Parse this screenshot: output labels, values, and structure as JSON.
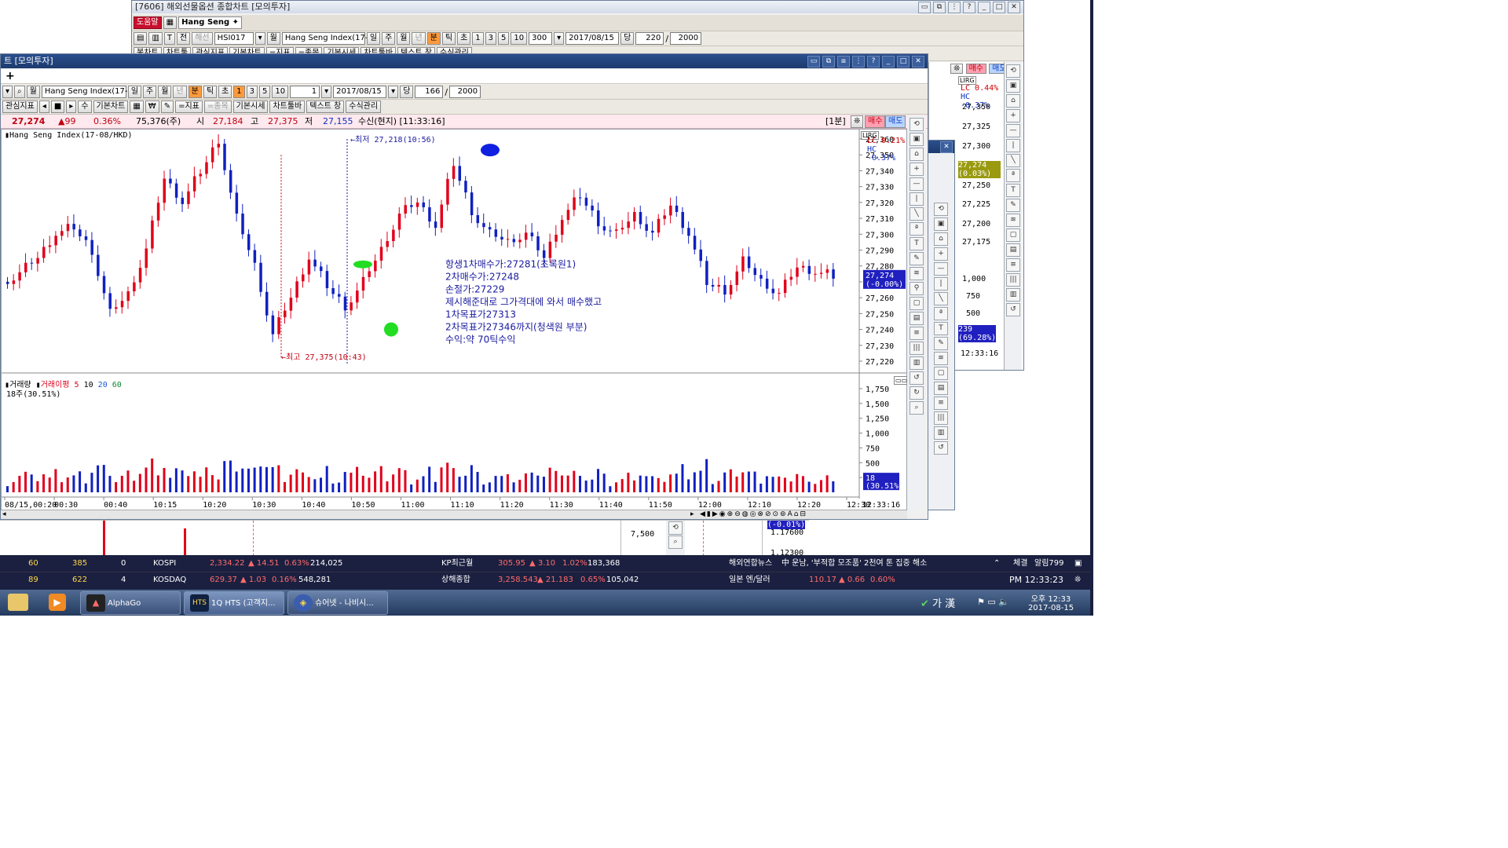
{
  "back_window": {
    "title": "[7606] 해외선물옵션 종합차트 [모의투자]",
    "help_btn": "도움말",
    "tab": "Hang Seng",
    "code": "HSI017",
    "period_btn": "월",
    "name_field": "Hang Seng Index(17-08",
    "tf": [
      "일",
      "주",
      "월",
      "년",
      "분",
      "틱",
      "초",
      "1",
      "3",
      "5",
      "10"
    ],
    "count": "300",
    "date": "2017/08/15",
    "dang": "당",
    "view_n": "220",
    "total_n": "2000",
    "row3": [
      "봉차트",
      "차트툴",
      "관심지표",
      "기본차트",
      "=지표",
      "=종목",
      "기본시세",
      "차트툴바",
      "텍스트 창",
      "수식관리"
    ],
    "right_panel": {
      "tag": "LIRG",
      "lc": "LC  0.44%",
      "hc": "HC -0.37%",
      "prices": [
        "27,350",
        "27,325",
        "27,300",
        "27,275",
        "27,250",
        "27,225",
        "27,200",
        "27,175"
      ],
      "cur_price": "27,274",
      "cur_pct": "(0.03%)",
      "vol_ticks": [
        "1,000",
        "750",
        "500"
      ],
      "vol_cur": "239",
      "vol_pct": "(69.28%)",
      "time": "12:33:16",
      "buy": "매수",
      "sell": "매도"
    }
  },
  "mid_window": {
    "time_label": "(-0.01%)",
    "vol_tick": "7,500",
    "rate": "1.17600",
    "rate2": "1.12300"
  },
  "main_window": {
    "title": "트 [모의투자]",
    "name_field": "Hang Seng Index(17-08",
    "tf": [
      "일",
      "주",
      "월",
      "년",
      "분",
      "틱",
      "초",
      "1",
      "3",
      "5",
      "10"
    ],
    "count": "1",
    "date": "2017/08/15",
    "dang": "당",
    "view_n": "166",
    "total_n": "2000",
    "row3": [
      "관심지표",
      "수",
      "기본차트",
      "=지표",
      "=종목",
      "기본시세",
      "차트툴바",
      "텍스트 창",
      "수식관리"
    ],
    "quote": {
      "price": "27,274",
      "change": "▲99",
      "pct": "0.36%",
      "volume": "75,376(주)",
      "open_label": "시",
      "open": "27,184",
      "high_label": "고",
      "high": "27,375",
      "low_label": "저",
      "low": "27,155",
      "feed": "수신(현지) [11:33:16]",
      "interval": "[1분]",
      "buy": "매수",
      "sell": "매도"
    },
    "chart_title": "Hang Seng Index(17-08/HKD)",
    "lc": "LC  0.21%",
    "hc": "HC -0.37%",
    "price_axis": [
      "27,360",
      "27,350",
      "27,340",
      "27,330",
      "27,320",
      "27,310",
      "27,300",
      "27,290",
      "27,280",
      "27,270",
      "27,260",
      "27,250",
      "27,240",
      "27,230",
      "27,220"
    ],
    "cur_price": "27,274",
    "cur_pct": "(-0.00%)",
    "annot_low": "←최저 27,218(10:56)",
    "annot_high": "←최고 27,375(10:43)",
    "notes": [
      "항생1차매수가:27281(초록원1)",
      "2차매수가:27248",
      "손절가:27229",
      "제시해준대로 그가격대에 와서 매수했고",
      "1차목표가27313",
      "2차목표가27346까지(청색원 부분)",
      "수익:약 70틱수익"
    ],
    "vol_title": "거래량",
    "vol_ma_title": "거래이평",
    "vol_ma_periods": [
      "5",
      "10",
      "20",
      "60"
    ],
    "vol_info": "18주(30.51%)",
    "vol_axis": [
      "1,750",
      "1,500",
      "1,250",
      "1,000",
      "750",
      "500",
      "250"
    ],
    "vol_cur": "18",
    "vol_cur_pct": "(30.51%)",
    "time_axis": [
      "08/15,00:20",
      "00:30",
      "00:40",
      "10:15",
      "10:20",
      "10:30",
      "10:40",
      "10:50",
      "11:00",
      "11:10",
      "11:20",
      "11:30",
      "11:40",
      "11:50",
      "12:00",
      "12:10",
      "12:20",
      "12:30"
    ],
    "last_time": "12:33:16",
    "colors": {
      "up": "#e0001a",
      "down": "#1020c0",
      "ma5": "#e0001a",
      "ma10": "#000000",
      "ma20": "#1a5ad8",
      "ma60": "#118833"
    }
  },
  "ticker": {
    "row1": {
      "a": "60",
      "b": "385",
      "c": "0",
      "idx1": "KOSPI",
      "v1": "2,334.22",
      "ch1": "▲ 14.51",
      "p1": "0.63%",
      "vol1": "214,025",
      "idx2": "KP최근월",
      "v2": "305.95",
      "ch2": "▲ 3.10",
      "p2": "1.02%",
      "vol2": "183,368",
      "news_label": "해외연합뉴스",
      "news": "中 운남, '부적합 모조품' 2천여 톤 집중 해소",
      "fill": "체결",
      "alarm": "알림799"
    },
    "row2": {
      "a": "89",
      "b": "622",
      "c": "4",
      "idx1": "KOSDAQ",
      "v1": "629.37",
      "ch1": "▲ 1.03",
      "p1": "0.16%",
      "vol1": "548,281",
      "idx2": "상해종합",
      "v2": "3,258.543",
      "ch2": "▲ 21.183",
      "p2": "0.65%",
      "vol2": "105,042",
      "fx_label": "일본 엔/달러",
      "fx": "110.17",
      "fxch": "▲ 0.66",
      "fxp": "0.60%",
      "clock": "PM 12:33:23"
    }
  },
  "taskbar": {
    "apps": [
      "AlphaGo",
      "1Q HTS (고객지...",
      "슈어넷 - 나비시..."
    ],
    "ime": "가 漢",
    "clock_time": "오후 12:33",
    "clock_date": "2017-08-15"
  }
}
